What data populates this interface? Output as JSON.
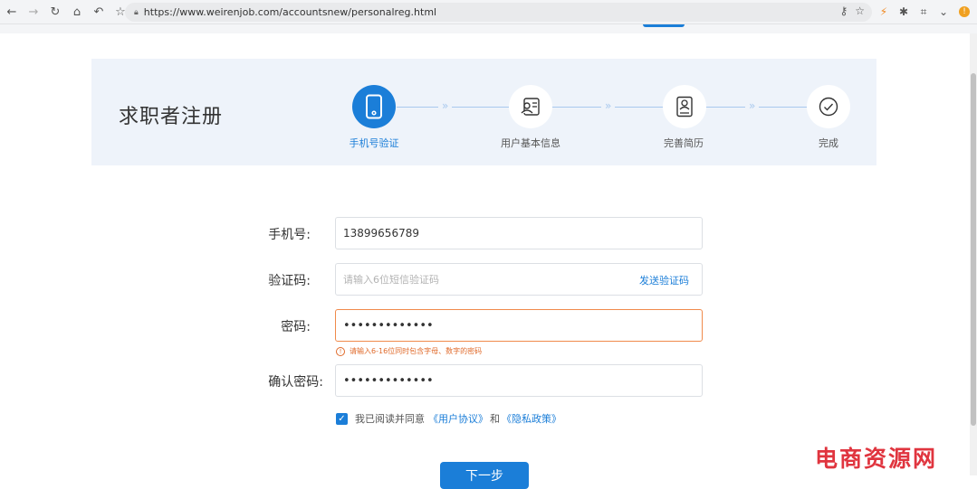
{
  "browser": {
    "url": "https://www.weirenjob.com/accountsnew/personalreg.html"
  },
  "page": {
    "title": "求职者注册"
  },
  "steps": [
    {
      "label": "手机号验证",
      "icon": "phone-icon",
      "active": true
    },
    {
      "label": "用户基本信息",
      "icon": "user-card-icon",
      "active": false
    },
    {
      "label": "完善简历",
      "icon": "resume-icon",
      "active": false
    },
    {
      "label": "完成",
      "icon": "check-circle-icon",
      "active": false
    }
  ],
  "connector_chevron": "»",
  "form": {
    "phone_label": "手机号:",
    "phone_value": "13899656789",
    "code_label": "验证码:",
    "code_placeholder": "请输入6位短信验证码",
    "send_code": "发送验证码",
    "password_label": "密码:",
    "password_dots": "•••••••••••••",
    "password_error": "请输入6-16位同时包含字母、数字的密码",
    "confirm_label": "确认密码:",
    "confirm_dots": "•••••••••••••",
    "agree_prefix": "我已阅读并同意",
    "agree_link1": "《用户协议》",
    "agree_and": "和",
    "agree_link2": "《隐私政策》",
    "agree_checked": true,
    "next_button": "下一步"
  },
  "watermark": "电商资源网",
  "colors": {
    "accent": "#1b7ed8",
    "error": "#e06a2a",
    "banner_bg": "#eef3fa"
  }
}
